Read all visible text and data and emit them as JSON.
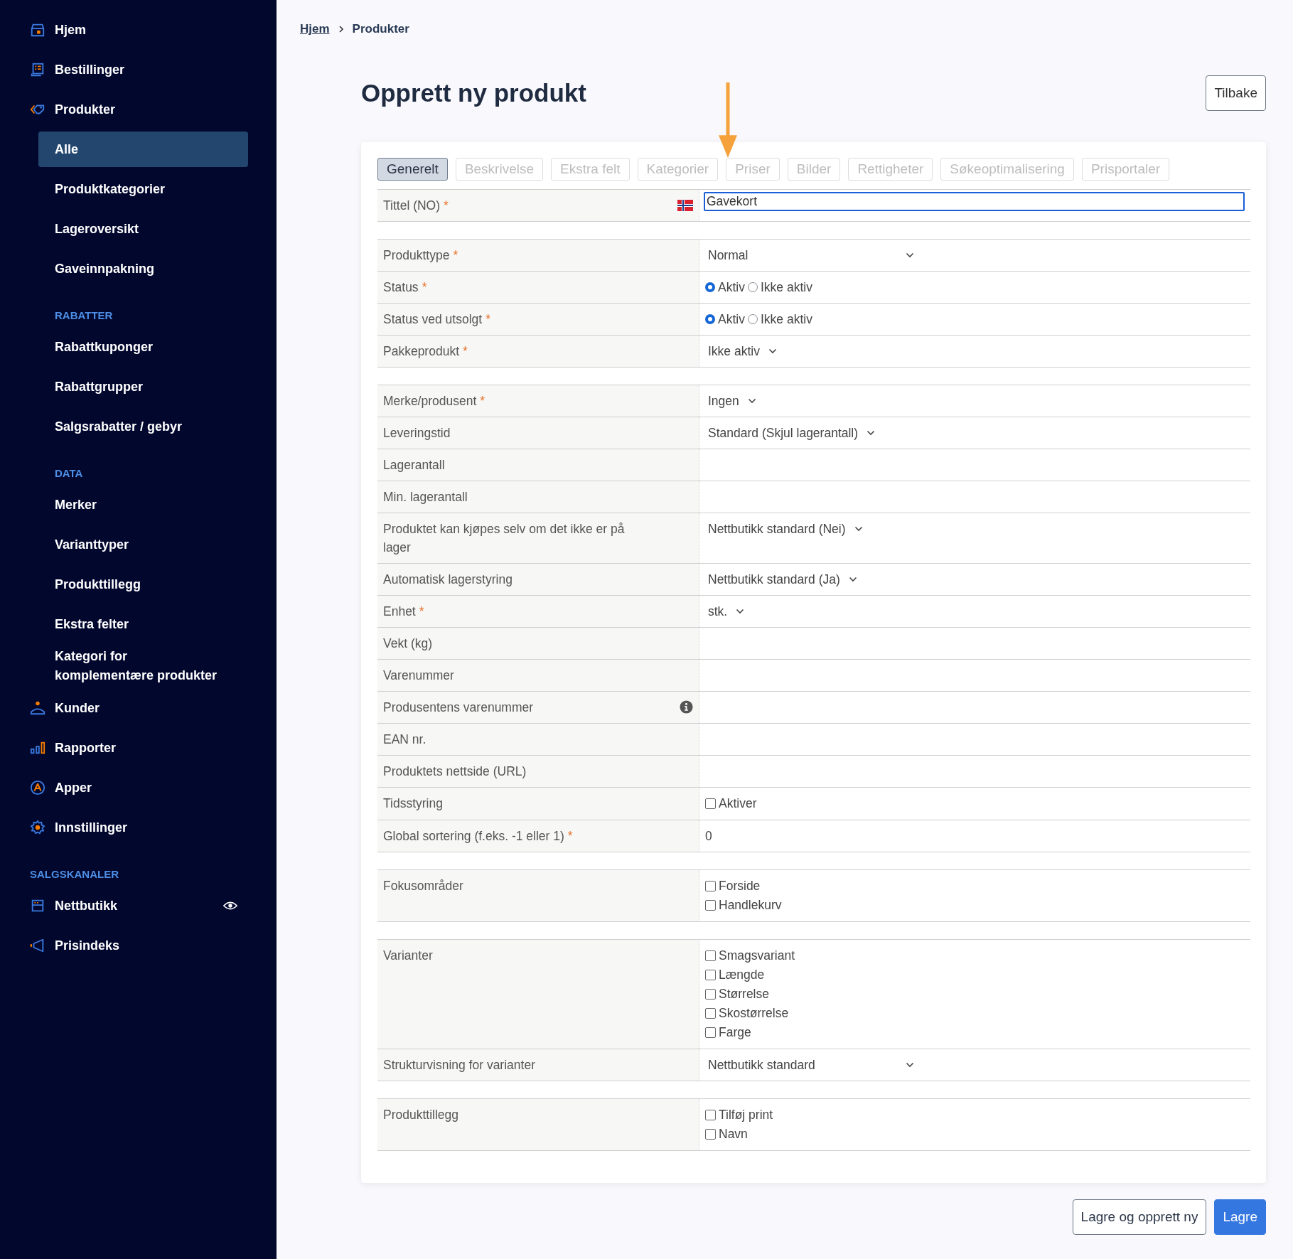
{
  "sidebar": {
    "items": [
      {
        "kind": "item",
        "label": "Hjem",
        "selected": false
      },
      {
        "kind": "item",
        "label": "Bestillinger",
        "selected": false
      },
      {
        "kind": "item",
        "label": "Produkter",
        "selected": false
      },
      {
        "kind": "subitem",
        "label": "Alle",
        "selected": true
      },
      {
        "kind": "subitem",
        "label": "Produktkategorier",
        "selected": false
      },
      {
        "kind": "subitem",
        "label": "Lageroversikt",
        "selected": false
      },
      {
        "kind": "subitem",
        "label": "Gaveinnpakning",
        "selected": false
      },
      {
        "kind": "heading",
        "label": "RABATTER"
      },
      {
        "kind": "subitem",
        "label": "Rabattkuponger",
        "selected": false
      },
      {
        "kind": "subitem",
        "label": "Rabattgrupper",
        "selected": false
      },
      {
        "kind": "subitem",
        "label": "Salgsrabatter / gebyr",
        "selected": false
      },
      {
        "kind": "heading",
        "label": "DATA"
      },
      {
        "kind": "subitem",
        "label": "Merker",
        "selected": false
      },
      {
        "kind": "subitem",
        "label": "Varianttyper",
        "selected": false
      },
      {
        "kind": "subitem",
        "label": "Produkttillegg",
        "selected": false
      },
      {
        "kind": "subitem",
        "label": "Ekstra felter",
        "selected": false
      },
      {
        "kind": "subitem",
        "label": "Kategori for komplementære produkter",
        "selected": false
      },
      {
        "kind": "item",
        "label": "Kunder",
        "selected": false
      },
      {
        "kind": "item",
        "label": "Rapporter",
        "selected": false
      },
      {
        "kind": "item",
        "label": "Apper",
        "selected": false
      },
      {
        "kind": "item",
        "label": "Innstillinger",
        "selected": false
      },
      {
        "kind": "heading",
        "label": "SALGSKANALER"
      },
      {
        "kind": "channel",
        "label": "Nettbutikk",
        "selected": false
      },
      {
        "kind": "item",
        "label": "Prisindeks",
        "selected": false
      }
    ]
  },
  "breadcrumb": [
    {
      "kind": "link",
      "label": "Hjem"
    },
    {
      "kind": "current",
      "label": "Produkter"
    }
  ],
  "page": {
    "title": "Opprett ny produkt",
    "back_button": "Tilbake"
  },
  "tabs": [
    {
      "label": "Generelt",
      "selected": true,
      "disabled": false
    },
    {
      "label": "Beskrivelse",
      "selected": false,
      "disabled": true
    },
    {
      "label": "Ekstra felt",
      "selected": false,
      "disabled": true
    },
    {
      "label": "Kategorier",
      "selected": false,
      "disabled": true
    },
    {
      "label": "Priser",
      "selected": false,
      "disabled": true
    },
    {
      "label": "Bilder",
      "selected": false,
      "disabled": true
    },
    {
      "label": "Rettigheter",
      "selected": false,
      "disabled": true
    },
    {
      "label": "Søkeoptimalisering",
      "selected": false,
      "disabled": true
    },
    {
      "label": "Prisportaler",
      "selected": false,
      "disabled": true
    }
  ],
  "form": {
    "groups": [
      {
        "rows": [
          {
            "kind": "localized-text",
            "label": "Tittel (NO)",
            "required_mark": "*",
            "info": false,
            "value": "Gavekort"
          }
        ]
      },
      {
        "rows": [
          {
            "kind": "select-wide",
            "label": "Produkttype",
            "required_mark": "*",
            "info": false,
            "value": "Normal"
          },
          {
            "kind": "radio",
            "label": "Status",
            "required_mark": "*",
            "info": false,
            "options": [
              {
                "label": "Aktiv",
                "selected": true
              },
              {
                "label": "Ikke aktiv",
                "selected": false
              }
            ]
          },
          {
            "kind": "radio",
            "label": "Status ved utsolgt",
            "required_mark": "*",
            "info": false,
            "options": [
              {
                "label": "Aktiv",
                "selected": true
              },
              {
                "label": "Ikke aktiv",
                "selected": false
              }
            ]
          },
          {
            "kind": "select",
            "label": "Pakkeprodukt",
            "required_mark": "*",
            "info": false,
            "value": "Ikke aktiv"
          }
        ]
      },
      {
        "rows": [
          {
            "kind": "select",
            "label": "Merke/produsent",
            "required_mark": "*",
            "info": false,
            "value": "Ingen"
          },
          {
            "kind": "select",
            "label": "Leveringstid",
            "info": false,
            "value": "Standard (Skjul lagerantall)"
          },
          {
            "kind": "empty",
            "label": "Lagerantall",
            "info": false
          },
          {
            "kind": "empty",
            "label": "Min. lagerantall",
            "info": false
          },
          {
            "kind": "select",
            "label": "Produktet kan kjøpes selv om det ikke er på lager",
            "info": false,
            "value": "Nettbutikk standard (Nei)"
          },
          {
            "kind": "select",
            "label": "Automatisk lagerstyring",
            "info": false,
            "value": "Nettbutikk standard (Ja)"
          },
          {
            "kind": "select",
            "label": "Enhet",
            "required_mark": "*",
            "info": false,
            "value": "stk."
          },
          {
            "kind": "empty",
            "label": "Vekt (kg)",
            "info": false
          },
          {
            "kind": "empty",
            "label": "Varenummer",
            "info": false
          },
          {
            "kind": "empty",
            "label": "Produsentens varenummer",
            "info": true
          },
          {
            "kind": "empty",
            "label": "EAN nr.",
            "info": false
          },
          {
            "kind": "empty",
            "label": "Produktets nettside (URL)",
            "info": false
          },
          {
            "kind": "checkboxes",
            "label": "Tidsstyring",
            "info": false,
            "options": [
              {
                "label": "Aktiver",
                "checked": false
              }
            ]
          },
          {
            "kind": "plain",
            "label": "Global sortering (f.eks. -1 eller 1)",
            "required_mark": "*",
            "info": false,
            "value": "0"
          }
        ]
      },
      {
        "rows": [
          {
            "kind": "checkboxes",
            "label": "Fokusområder",
            "info": false,
            "options": [
              {
                "label": "Forside",
                "checked": false
              },
              {
                "label": "Handlekurv",
                "checked": false
              }
            ]
          }
        ]
      },
      {
        "rows": [
          {
            "kind": "checkboxes",
            "label": "Varianter",
            "info": false,
            "options": [
              {
                "label": "Smagsvariant",
                "checked": false
              },
              {
                "label": "Længde",
                "checked": false
              },
              {
                "label": "Størrelse",
                "checked": false
              },
              {
                "label": "Skostørrelse",
                "checked": false
              },
              {
                "label": "Farge",
                "checked": false
              }
            ]
          },
          {
            "kind": "select-wide",
            "label": "Strukturvisning for varianter",
            "info": false,
            "value": "Nettbutikk standard"
          }
        ]
      },
      {
        "rows": [
          {
            "kind": "checkboxes",
            "label": "Produkttillegg",
            "info": false,
            "options": [
              {
                "label": "Tilføj print",
                "checked": false
              },
              {
                "label": "Navn",
                "checked": false
              }
            ]
          }
        ]
      }
    ]
  },
  "actions": [
    {
      "kind": "secondary",
      "label": "Lagre og opprett ny"
    },
    {
      "kind": "primary",
      "label": "Lagre"
    }
  ]
}
